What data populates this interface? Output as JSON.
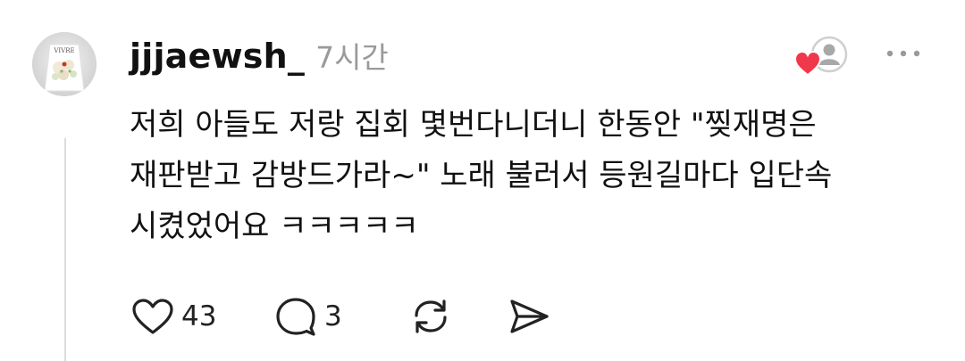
{
  "post": {
    "username": "jjjaewsh_",
    "time": "7시간",
    "body": "저희 아들도 저랑 집회 몇번다니더니 한동안 \"찢재명은\n재판받고 감방드가라~\" 노래 불러서 등원길마다 입단속\n시켰었어요 ㅋㅋㅋㅋㅋ",
    "likes": "43",
    "replies": "3"
  },
  "avatar": {
    "sticker_text": "VIVRE"
  },
  "icons": {
    "like": "heart-icon",
    "reply": "speech-bubble-icon",
    "repost": "repost-icon",
    "share": "send-icon",
    "more": "more-dots-icon",
    "liked_by": "liked-by-avatar-heart-icon"
  },
  "colors": {
    "text": "#111111",
    "muted": "#9a9a9a",
    "heart_accent": "#f0384a",
    "thread_line": "#dcdcdc"
  }
}
